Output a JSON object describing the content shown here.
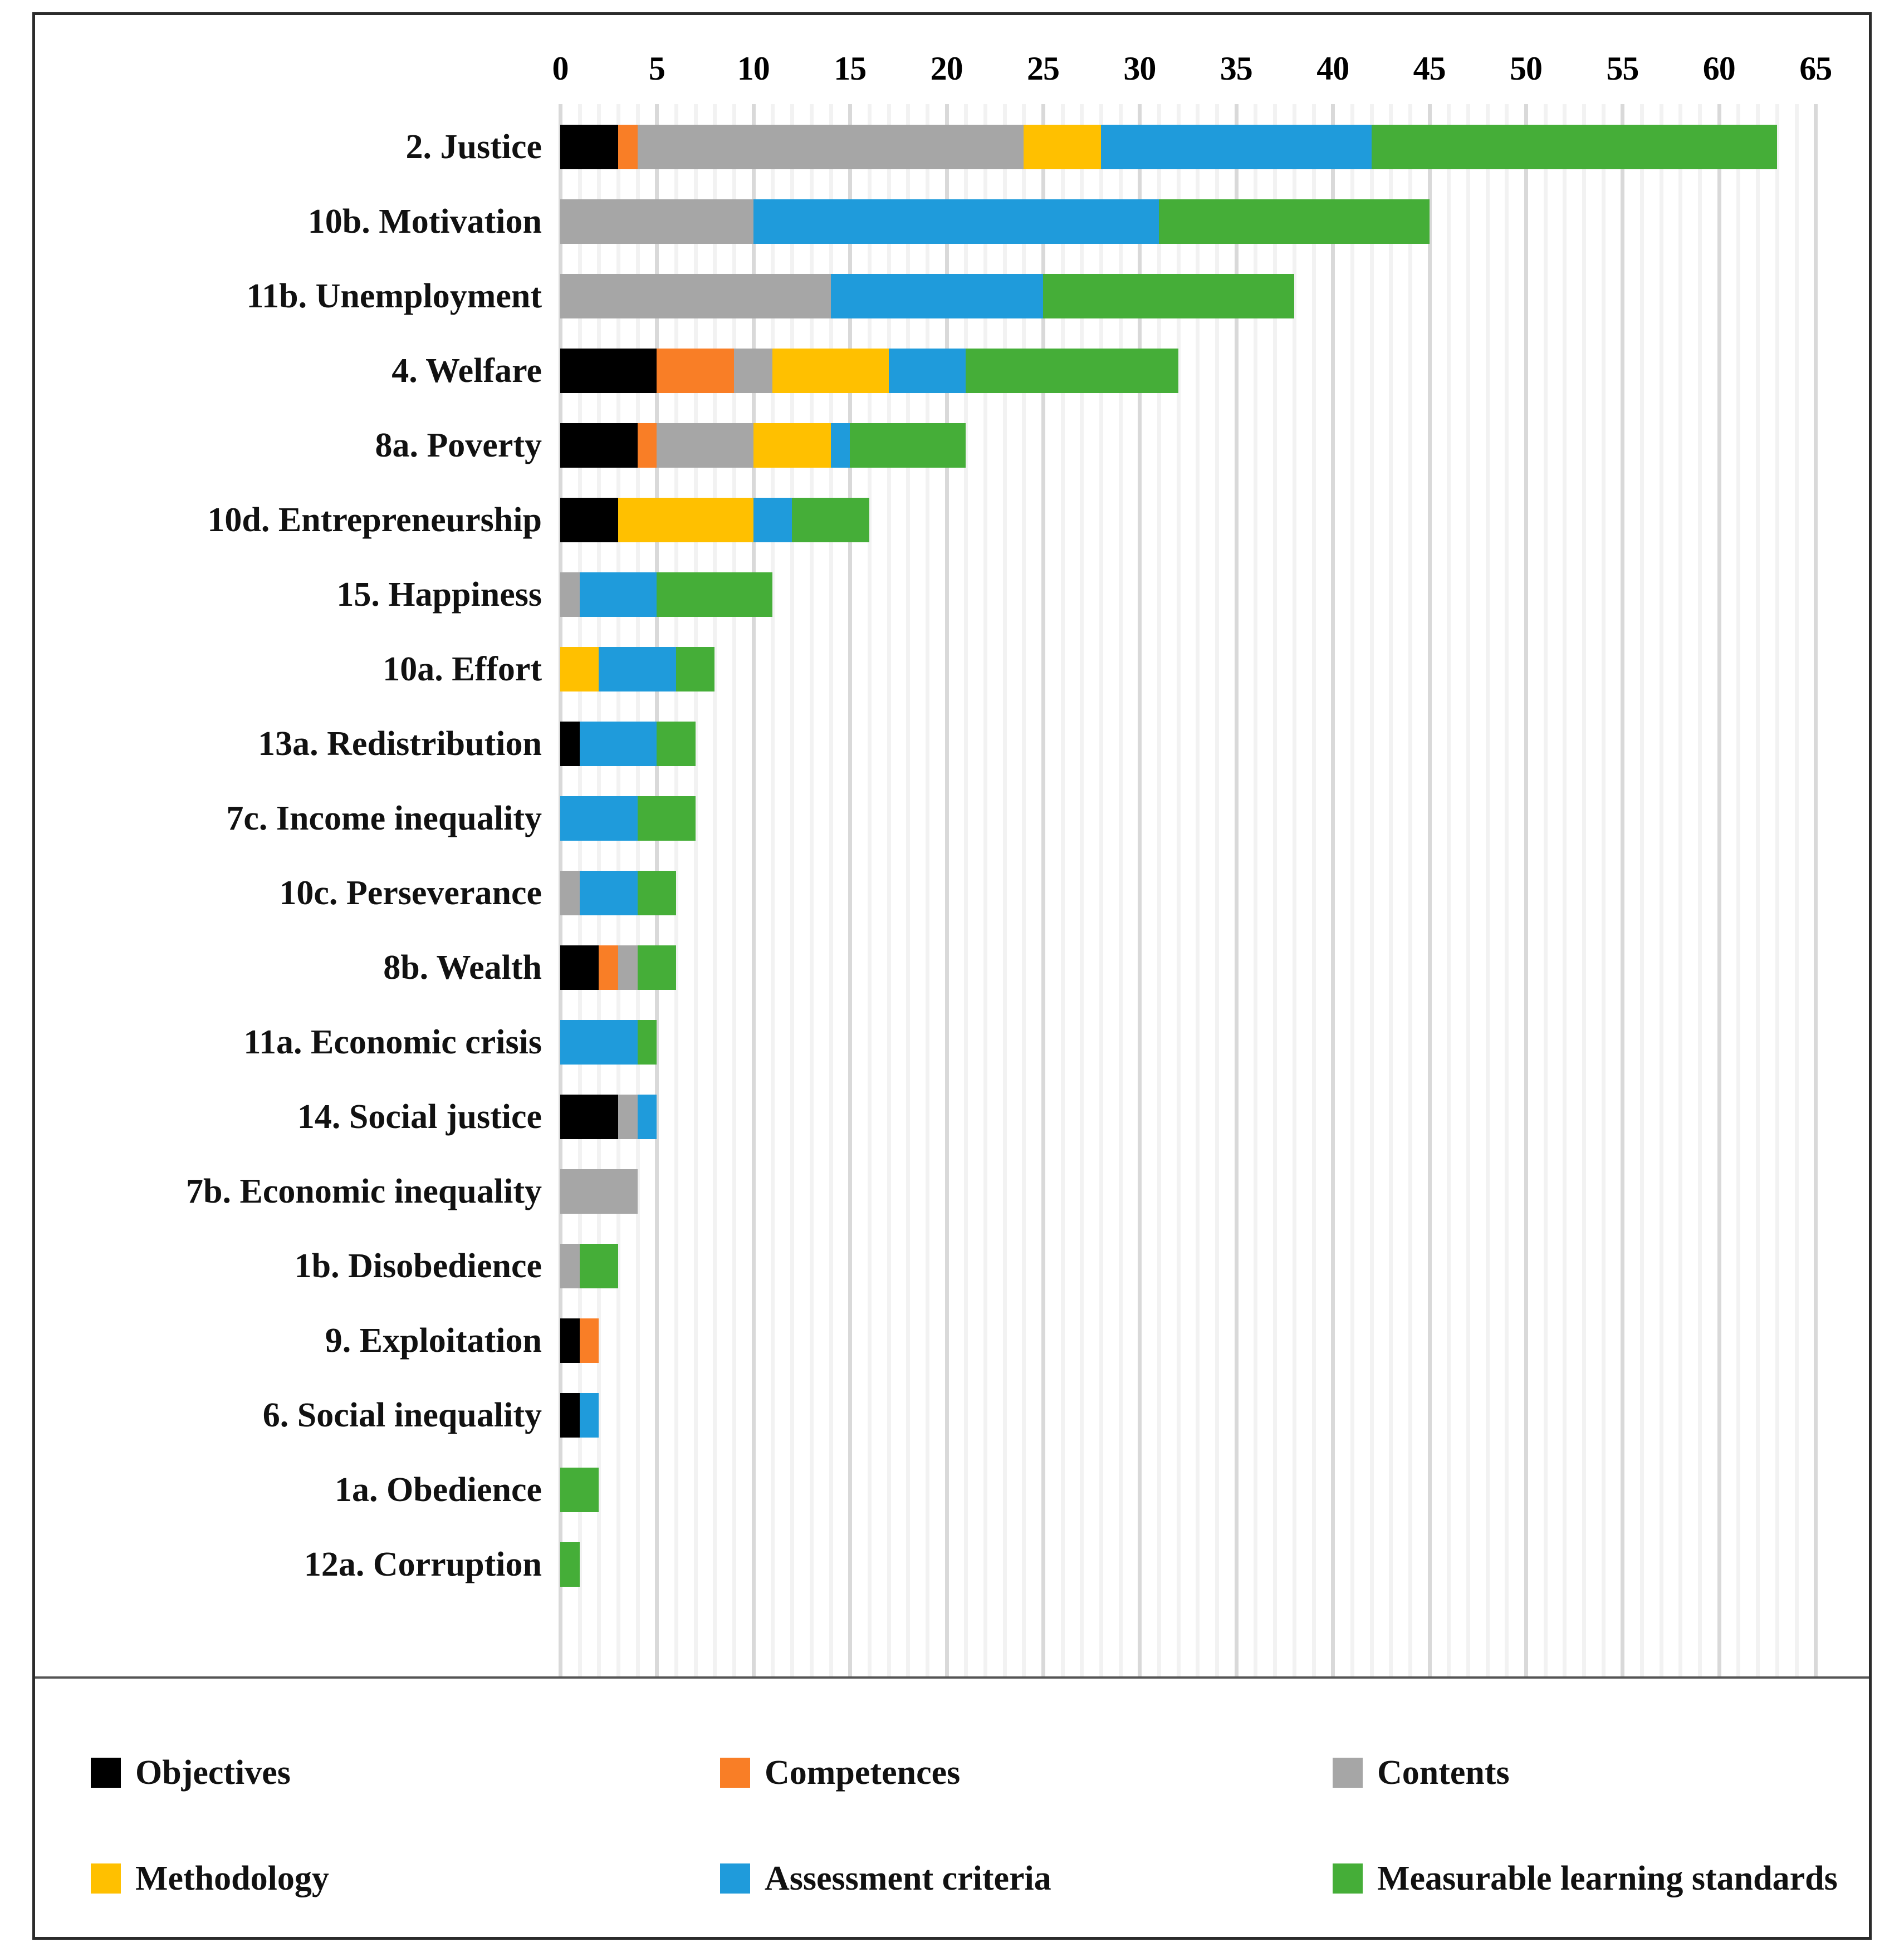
{
  "chart_data": {
    "type": "bar",
    "orientation": "horizontal",
    "stacked": true,
    "title": "",
    "xlabel": "",
    "ylabel": "",
    "xlim": [
      0,
      65
    ],
    "xticks": [
      0,
      5,
      10,
      15,
      20,
      25,
      30,
      35,
      40,
      45,
      50,
      55,
      60,
      65
    ],
    "grid": true,
    "legend_position": "bottom",
    "categories": [
      "2. Justice",
      "10b. Motivation",
      "11b. Unemployment",
      "4. Welfare",
      "8a. Poverty",
      "10d. Entrepreneurship",
      "15. Happiness",
      "10a. Effort",
      "13a. Redistribution",
      "7c. Income inequality",
      "10c. Perseverance",
      "8b. Wealth",
      "11a. Economic crisis",
      "14. Social justice",
      "7b. Economic inequality",
      "1b. Disobedience",
      "9. Exploitation",
      "6. Social inequality",
      "1a. Obedience",
      "12a. Corruption"
    ],
    "series": [
      {
        "name": "Objectives",
        "color": "#000000",
        "values": [
          3,
          0,
          0,
          5,
          4,
          3,
          0,
          0,
          1,
          0,
          0,
          2,
          0,
          3,
          0,
          0,
          1,
          1,
          0,
          0
        ]
      },
      {
        "name": "Competences",
        "color": "#F97E26",
        "values": [
          1,
          0,
          0,
          4,
          1,
          0,
          0,
          0,
          0,
          0,
          0,
          1,
          0,
          0,
          0,
          0,
          1,
          0,
          0,
          0
        ]
      },
      {
        "name": "Contents",
        "color": "#A6A6A6",
        "values": [
          20,
          10,
          14,
          2,
          5,
          0,
          1,
          0,
          0,
          0,
          1,
          1,
          0,
          1,
          4,
          1,
          0,
          0,
          0,
          0
        ]
      },
      {
        "name": "Methodology",
        "color": "#FFC000",
        "values": [
          4,
          0,
          0,
          6,
          4,
          7,
          0,
          2,
          0,
          0,
          0,
          0,
          0,
          0,
          0,
          0,
          0,
          0,
          0,
          0
        ]
      },
      {
        "name": "Assessment criteria",
        "color": "#1F9BDB",
        "values": [
          14,
          21,
          11,
          4,
          1,
          2,
          4,
          4,
          4,
          4,
          3,
          0,
          4,
          1,
          0,
          0,
          0,
          1,
          0,
          0
        ]
      },
      {
        "name": "Measurable learning standards",
        "color": "#45AE38",
        "values": [
          21,
          14,
          13,
          11,
          6,
          4,
          6,
          2,
          2,
          3,
          2,
          2,
          1,
          0,
          0,
          2,
          0,
          0,
          2,
          1
        ]
      }
    ],
    "totals": [
      63,
      45,
      38,
      32,
      21,
      16,
      11,
      8,
      7,
      7,
      6,
      6,
      5,
      5,
      4,
      3,
      2,
      2,
      2,
      1
    ]
  },
  "legend": {
    "items": [
      {
        "label": "Objectives",
        "color": "#000000"
      },
      {
        "label": "Competences",
        "color": "#F97E26"
      },
      {
        "label": "Contents",
        "color": "#A6A6A6"
      },
      {
        "label": "Methodology",
        "color": "#FFC000"
      },
      {
        "label": "Assessment criteria",
        "color": "#1F9BDB"
      },
      {
        "label": "Measurable learning standards",
        "color": "#45AE38"
      }
    ]
  }
}
